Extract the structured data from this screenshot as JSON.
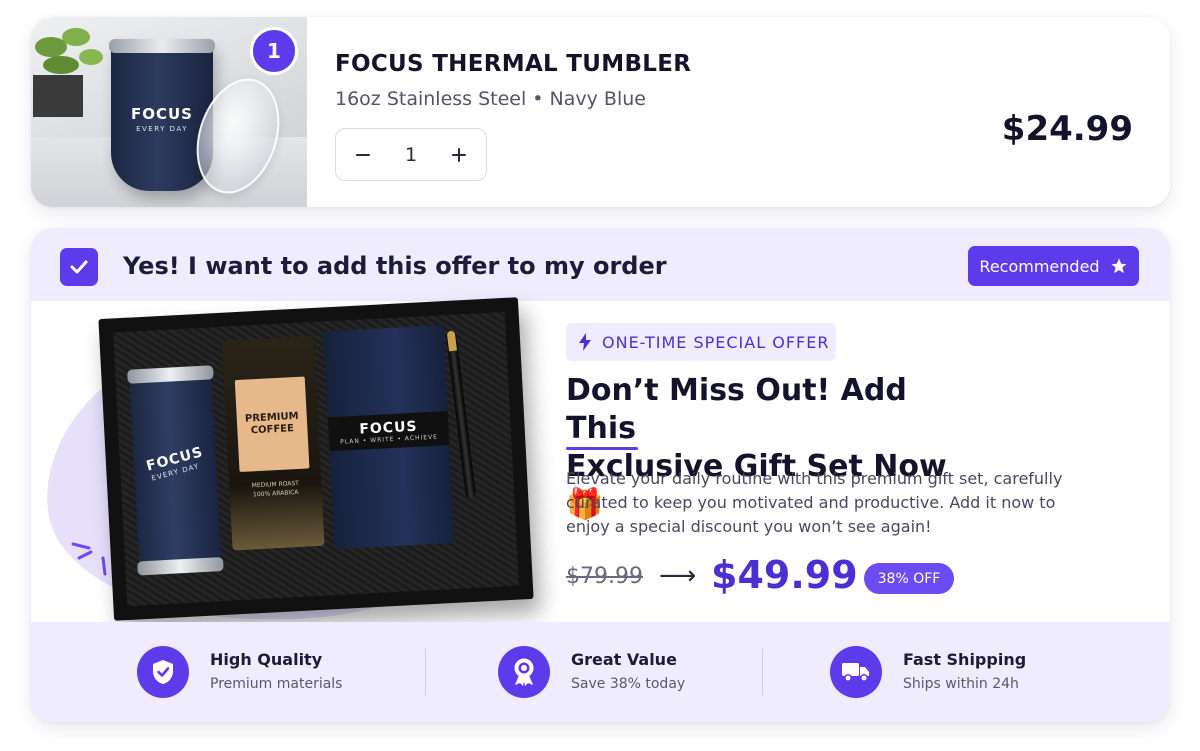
{
  "cart_item": {
    "quantity_badge": "1",
    "image_brand": "FOCUS",
    "image_tagline": "EVERY DAY",
    "title": "FOCUS THERMAL TUMBLER",
    "variant": "16oz Stainless Steel • Navy Blue",
    "quantity": "1",
    "price": "$24.99"
  },
  "offer": {
    "checkbox_checked": true,
    "headline": "Yes! I want to add this offer to my order",
    "recommended_label": "Recommended",
    "gift_image": {
      "tumbler_brand": "FOCUS",
      "tumbler_tagline": "EVERY DAY",
      "coffee_line1": "PREMIUM",
      "coffee_line2": "COFFEE",
      "coffee_foot1": "MEDIUM ROAST",
      "coffee_foot2": "100% ARABICA",
      "notebook_brand": "FOCUS",
      "notebook_tagline": "PLAN • WRITE • ACHIEVE"
    },
    "tag": "ONE-TIME SPECIAL OFFER",
    "title_line1": "Don’t Miss Out! Add This",
    "title_line2": "Exclusive Gift Set Now 🎁",
    "description": "Elevate your daily routine with this premium gift set, carefully curated to keep you motivated and productive. Add it now to enjoy a special discount you won’t see again!",
    "old_price": "$79.99",
    "arrow": "⟶",
    "new_price": "$49.99",
    "discount_badge": "38% OFF"
  },
  "features": [
    {
      "icon": "shield-check-icon",
      "title": "High Quality",
      "subtitle": "Premium materials"
    },
    {
      "icon": "award-badge-icon",
      "title": "Great Value",
      "subtitle": "Save 38% today"
    },
    {
      "icon": "truck-icon",
      "title": "Fast Shipping",
      "subtitle": "Ships within 24h"
    }
  ],
  "colors": {
    "accent": "#5b3bea",
    "accent_light": "#efecfd",
    "text_dark": "#15132b"
  }
}
